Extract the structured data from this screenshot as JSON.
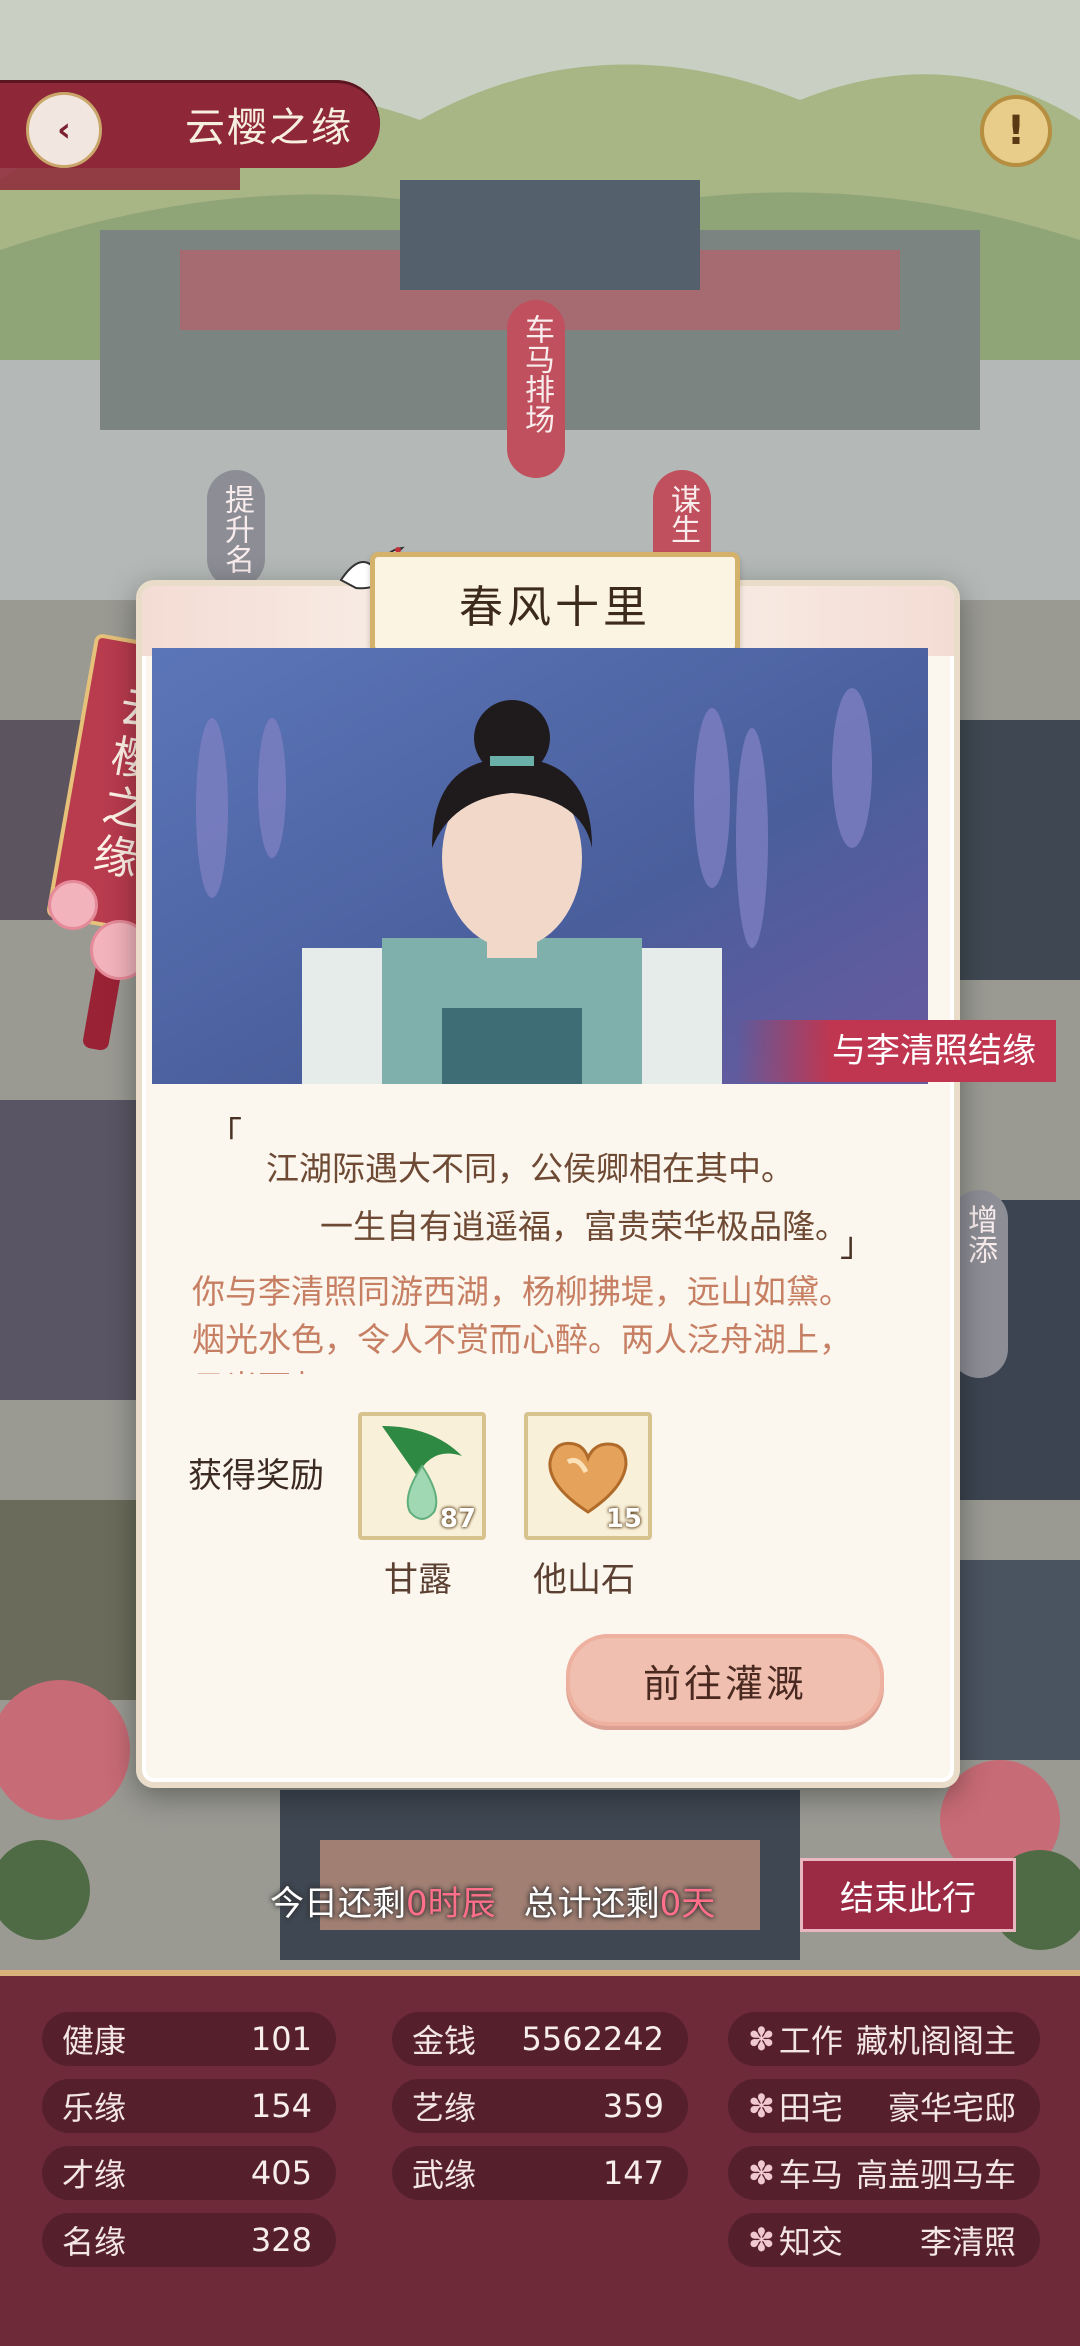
{
  "header": {
    "title": "云樱之缘"
  },
  "map_labels": {
    "chema": "车马排场",
    "tisheng": "提升名",
    "mousheng": "谋生",
    "zengtiao": "增添",
    "side_banner": "云樱之缘"
  },
  "dialog": {
    "title": "春风十里",
    "caption": "与李清照结缘",
    "poem": {
      "open": "「",
      "line1": "江湖际遇大不同，公侯卿相在其中。",
      "line2": "一生自有逍遥福，富贵荣华极品隆。",
      "close": "」"
    },
    "story": "你与李清照同游西湖，杨柳拂堤，远山如黛。烟光水色，令人不赏而心醉。两人泛舟湖上，日光西归。",
    "reward_label": "获得奖励",
    "rewards": [
      {
        "name": "甘露",
        "count": "87",
        "icon": "dew-drop-icon"
      },
      {
        "name": "他山石",
        "count": "15",
        "icon": "heart-stone-icon"
      }
    ],
    "go_button": "前往灌溉"
  },
  "remaining": {
    "today_label": "今日还剩",
    "today_value": "0时辰",
    "total_label": "总计还剩",
    "total_value": "0天"
  },
  "end_button": "结束此行",
  "stats": {
    "col1": [
      {
        "k": "健康",
        "v": "101"
      },
      {
        "k": "乐缘",
        "v": "154"
      },
      {
        "k": "才缘",
        "v": "405"
      },
      {
        "k": "名缘",
        "v": "328"
      }
    ],
    "col2": [
      {
        "k": "金钱",
        "v": "5562242"
      },
      {
        "k": "艺缘",
        "v": "359"
      },
      {
        "k": "武缘",
        "v": "147"
      }
    ],
    "col3": [
      {
        "k": "工作",
        "v": "藏机阁阁主"
      },
      {
        "k": "田宅",
        "v": "豪华宅邸"
      },
      {
        "k": "车马",
        "v": "高盖驷马车"
      },
      {
        "k": "知交",
        "v": "李清照"
      }
    ]
  },
  "colors": {
    "accent": "#8e2737",
    "panel": "#6e2a38",
    "button": "#f0bfb0"
  }
}
